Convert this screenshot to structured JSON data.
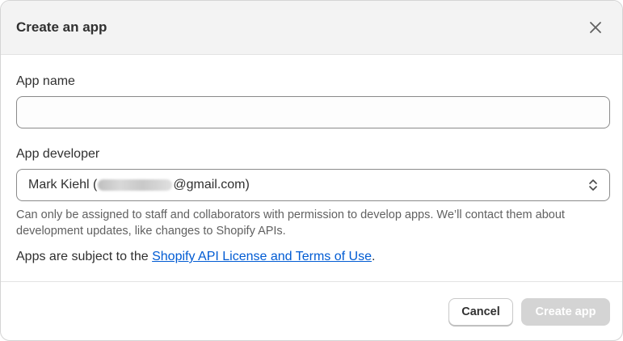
{
  "modal": {
    "title": "Create an app"
  },
  "fields": {
    "app_name": {
      "label": "App name",
      "value": "",
      "placeholder": ""
    },
    "app_developer": {
      "label": "App developer",
      "selected_prefix": "Mark Kiehl (",
      "selected_suffix": "@gmail.com)",
      "help_text": "Can only be assigned to staff and collaborators with permission to develop apps. We’ll contact them about development updates, like changes to Shopify APIs."
    }
  },
  "terms": {
    "prefix": "Apps are subject to the ",
    "link_text": "Shopify API License and Terms of Use",
    "suffix": "."
  },
  "footer": {
    "cancel_label": "Cancel",
    "create_label": "Create app"
  },
  "icons": {
    "close": "close-icon",
    "select_chevron": "chevron-up-down-icon"
  },
  "colors": {
    "link": "#005bd3",
    "disabled_button": "#d4d4d4",
    "header_bg": "#f3f3f3"
  }
}
